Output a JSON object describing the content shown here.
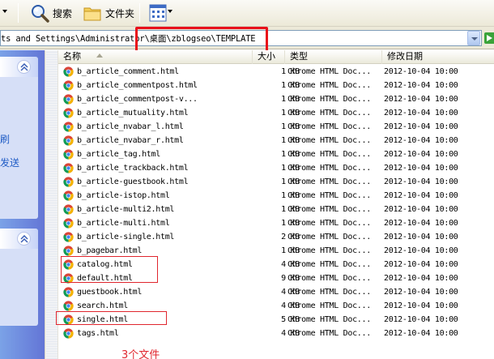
{
  "toolbar": {
    "search_label": "搜索",
    "folders_label": "文件夹"
  },
  "address": {
    "path": "ts and Settings\\Administrator\\桌面\\zblogseo\\TEMPLATE"
  },
  "left_pane": {
    "links": [
      "刷",
      "发送"
    ]
  },
  "columns": {
    "name": "名称",
    "size": "大小",
    "type": "类型",
    "modified": "修改日期"
  },
  "files": [
    {
      "name": "b_article_comment.html",
      "size": "1 KB",
      "type": "Chrome HTML Doc...",
      "modified": "2012-10-04 10:00"
    },
    {
      "name": "b_article_commentpost.html",
      "size": "1 KB",
      "type": "Chrome HTML Doc...",
      "modified": "2012-10-04 10:00"
    },
    {
      "name": "b_article_commentpost-v...",
      "size": "1 KB",
      "type": "Chrome HTML Doc...",
      "modified": "2012-10-04 10:00"
    },
    {
      "name": "b_article_mutuality.html",
      "size": "1 KB",
      "type": "Chrome HTML Doc...",
      "modified": "2012-10-04 10:00"
    },
    {
      "name": "b_article_nvabar_l.html",
      "size": "1 KB",
      "type": "Chrome HTML Doc...",
      "modified": "2012-10-04 10:00"
    },
    {
      "name": "b_article_nvabar_r.html",
      "size": "1 KB",
      "type": "Chrome HTML Doc...",
      "modified": "2012-10-04 10:00"
    },
    {
      "name": "b_article_tag.html",
      "size": "1 KB",
      "type": "Chrome HTML Doc...",
      "modified": "2012-10-04 10:00"
    },
    {
      "name": "b_article_trackback.html",
      "size": "1 KB",
      "type": "Chrome HTML Doc...",
      "modified": "2012-10-04 10:00"
    },
    {
      "name": "b_article-guestbook.html",
      "size": "1 KB",
      "type": "Chrome HTML Doc...",
      "modified": "2012-10-04 10:00"
    },
    {
      "name": "b_article-istop.html",
      "size": "1 KB",
      "type": "Chrome HTML Doc...",
      "modified": "2012-10-04 10:00"
    },
    {
      "name": "b_article-multi2.html",
      "size": "1 KB",
      "type": "Chrome HTML Doc...",
      "modified": "2012-10-04 10:00"
    },
    {
      "name": "b_article-multi.html",
      "size": "1 KB",
      "type": "Chrome HTML Doc...",
      "modified": "2012-10-04 10:00"
    },
    {
      "name": "b_article-single.html",
      "size": "2 KB",
      "type": "Chrome HTML Doc...",
      "modified": "2012-10-04 10:00"
    },
    {
      "name": "b_pagebar.html",
      "size": "1 KB",
      "type": "Chrome HTML Doc...",
      "modified": "2012-10-04 10:00"
    },
    {
      "name": "catalog.html",
      "size": "4 KB",
      "type": "Chrome HTML Doc...",
      "modified": "2012-10-04 10:00"
    },
    {
      "name": "default.html",
      "size": "9 KB",
      "type": "Chrome HTML Doc...",
      "modified": "2012-10-04 10:00"
    },
    {
      "name": "guestbook.html",
      "size": "4 KB",
      "type": "Chrome HTML Doc...",
      "modified": "2012-10-04 10:00"
    },
    {
      "name": "search.html",
      "size": "4 KB",
      "type": "Chrome HTML Doc...",
      "modified": "2012-10-04 10:00"
    },
    {
      "name": "single.html",
      "size": "5 KB",
      "type": "Chrome HTML Doc...",
      "modified": "2012-10-04 10:00"
    },
    {
      "name": "tags.html",
      "size": "4 KB",
      "type": "Chrome HTML Doc...",
      "modified": "2012-10-04 10:00"
    }
  ],
  "annotation": {
    "note": "3个文件",
    "color": "#e0262e"
  },
  "icons": {
    "file_icon": "chrome-icon",
    "search_icon": "magnifier-icon",
    "folders_icon": "folder-icon",
    "views_icon": "views-grid-icon"
  }
}
